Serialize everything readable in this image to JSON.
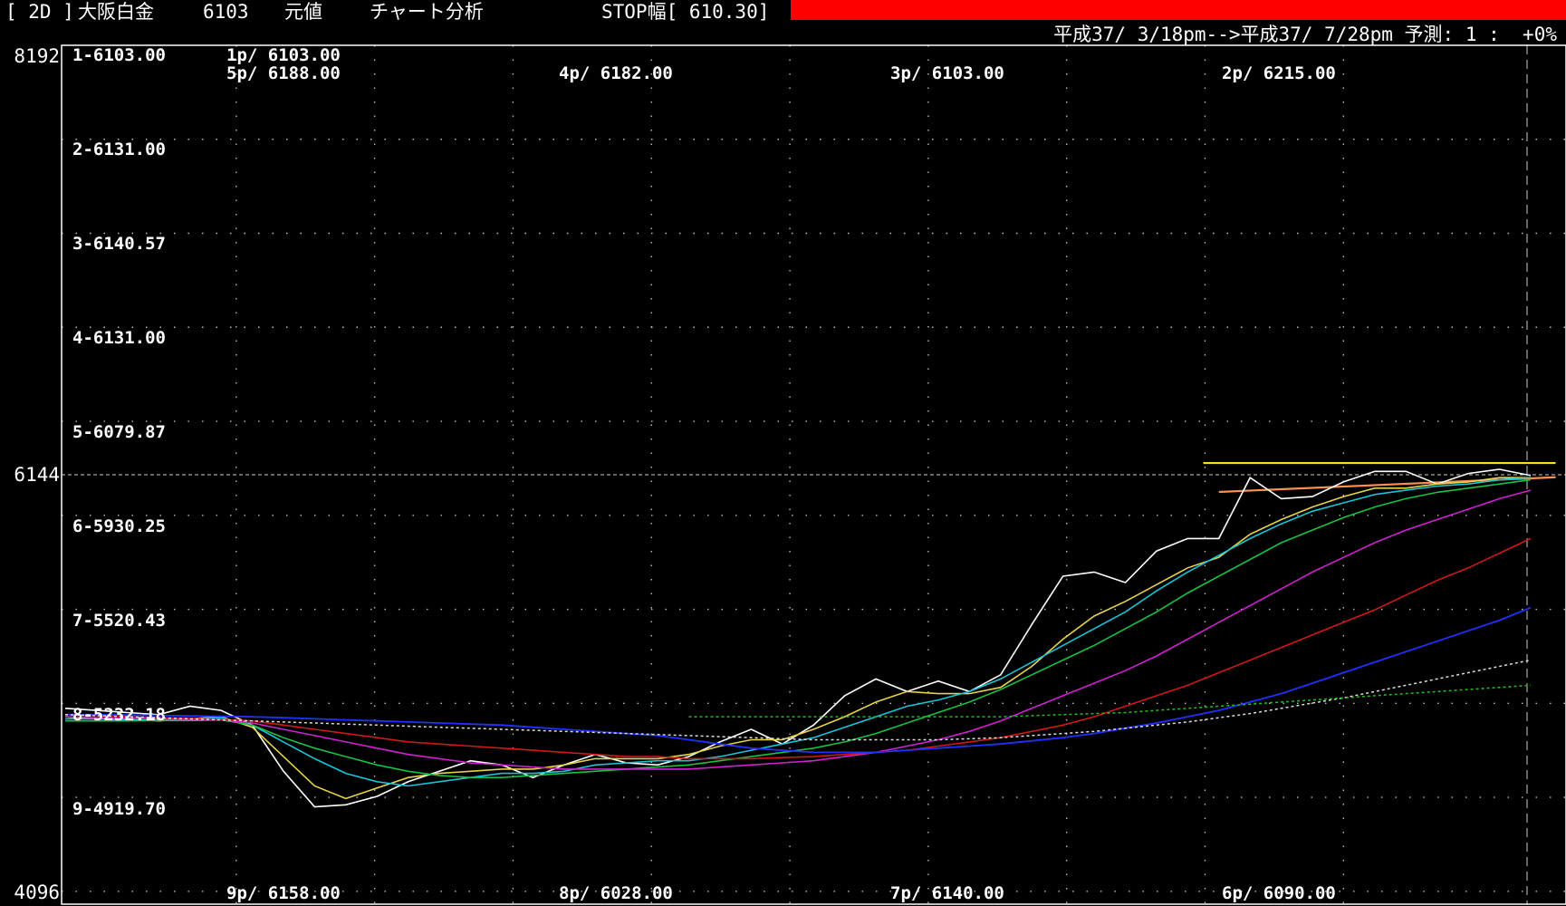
{
  "header": {
    "period": "[ 2D ]",
    "symbol": "大阪白金",
    "price": "6103",
    "mode": "元値",
    "analysis": "チャート分析",
    "stop": "STOP幅[ 610.30]",
    "range": "平成37/ 3/18pm-->平成37/ 7/28pm 予測: 1 :  +0%"
  },
  "axis": {
    "y_top": "8192",
    "y_mid": "6144",
    "y_bottom": "4096"
  },
  "colors": {
    "background": "#000000",
    "redbar": "#ff0000",
    "price": "#ffffff",
    "ma1": "#e6d34a",
    "ma2": "#18c4d8",
    "ma3": "#18c044",
    "ma4": "#d020d0",
    "ma5": "#d01818",
    "ma6": "#2030ff",
    "trend_top": "#ffe020",
    "trend_low": "#ff9050"
  },
  "chart_data": {
    "type": "line",
    "x": [
      0,
      1,
      2,
      3,
      4,
      5,
      6,
      7,
      8,
      9,
      10,
      11,
      12,
      13,
      14,
      15,
      16,
      17,
      18,
      19,
      20,
      21,
      22,
      23,
      24,
      25,
      26,
      27,
      28,
      29,
      30,
      31,
      32,
      33,
      34,
      35,
      36,
      37,
      38,
      39,
      40,
      41,
      42,
      43,
      44,
      45,
      46,
      47
    ],
    "ylim": [
      4096,
      8192
    ],
    "grid": true,
    "levels": [
      {
        "label": "1-6103.00"
      },
      {
        "label": "2-6131.00"
      },
      {
        "label": "3-6140.57"
      },
      {
        "label": "4-6131.00"
      },
      {
        "label": "5-6079.87"
      },
      {
        "label": "6-5930.25"
      },
      {
        "label": "7-5520.43"
      },
      {
        "label": "8-5232.18"
      },
      {
        "label": "9-4919.70"
      }
    ],
    "series_labels": [
      {
        "text": "1p/ 6103.00"
      },
      {
        "text": "5p/ 6188.00"
      },
      {
        "text": "4p/ 6182.00"
      },
      {
        "text": "3p/ 6103.00"
      },
      {
        "text": "2p/ 6215.00"
      },
      {
        "text": "9p/ 6158.00"
      },
      {
        "text": "8p/ 6028.00"
      },
      {
        "text": "7p/ 6140.00"
      },
      {
        "text": "6p/ 6090.00"
      }
    ],
    "series": [
      {
        "values": [
          5030,
          5020,
          5010,
          5000,
          5040,
          5020,
          4950,
          4730,
          4560,
          4570,
          4610,
          4680,
          4730,
          4780,
          4760,
          4700,
          4760,
          4810,
          4770,
          4760,
          4800,
          4870,
          4930,
          4860,
          4950,
          5090,
          5170,
          5110,
          5160,
          5110,
          5190,
          5430,
          5660,
          5680,
          5630,
          5780,
          5840,
          5840,
          6130,
          6030,
          6040,
          6110,
          6160,
          6160,
          6100,
          6150,
          6170,
          6140
        ]
      },
      {
        "values": [
          4990,
          4980,
          4980,
          4970,
          4980,
          4990,
          4940,
          4800,
          4660,
          4600,
          4650,
          4700,
          4720,
          4730,
          4740,
          4740,
          4760,
          4790,
          4790,
          4790,
          4810,
          4850,
          4880,
          4880,
          4930,
          4990,
          5060,
          5110,
          5100,
          5100,
          5130,
          5230,
          5360,
          5470,
          5540,
          5620,
          5700,
          5750,
          5860,
          5930,
          5990,
          6040,
          6080,
          6080,
          6100,
          6110,
          6130,
          6130
        ]
      },
      {
        "values": [
          4980,
          4980,
          4975,
          4975,
          4978,
          4985,
          4950,
          4870,
          4790,
          4720,
          4680,
          4660,
          4680,
          4700,
          4720,
          4720,
          4730,
          4760,
          4770,
          4780,
          4780,
          4800,
          4830,
          4860,
          4890,
          4940,
          4990,
          5040,
          5070,
          5110,
          5170,
          5250,
          5330,
          5410,
          5490,
          5590,
          5680,
          5760,
          5840,
          5910,
          5970,
          6010,
          6050,
          6070,
          6090,
          6100,
          6120,
          6130
        ]
      },
      {
        "values": [
          4970,
          4970,
          4970,
          4972,
          4972,
          4975,
          4950,
          4890,
          4840,
          4800,
          4760,
          4730,
          4710,
          4700,
          4700,
          4710,
          4720,
          4730,
          4740,
          4750,
          4760,
          4780,
          4800,
          4820,
          4840,
          4870,
          4910,
          4960,
          5010,
          5060,
          5120,
          5190,
          5260,
          5330,
          5410,
          5490,
          5580,
          5660,
          5740,
          5820,
          5880,
          5940,
          5990,
          6030,
          6060,
          6080,
          6100,
          6120
        ]
      },
      {
        "values": [
          4990,
          4985,
          4982,
          4980,
          4978,
          4975,
          4960,
          4930,
          4900,
          4870,
          4840,
          4810,
          4790,
          4770,
          4760,
          4750,
          4740,
          4740,
          4740,
          4740,
          4740,
          4750,
          4760,
          4770,
          4780,
          4800,
          4820,
          4850,
          4880,
          4920,
          4970,
          5030,
          5090,
          5150,
          5210,
          5280,
          5360,
          5440,
          5520,
          5600,
          5680,
          5750,
          5820,
          5880,
          5930,
          5980,
          6030,
          6070
        ]
      },
      {
        "values": [
          5000,
          4995,
          4990,
          4985,
          4982,
          4978,
          4970,
          4950,
          4930,
          4910,
          4890,
          4870,
          4860,
          4850,
          4840,
          4830,
          4820,
          4810,
          4800,
          4800,
          4790,
          4790,
          4790,
          4795,
          4800,
          4810,
          4820,
          4830,
          4850,
          4870,
          4890,
          4920,
          4950,
          4990,
          5040,
          5090,
          5140,
          5200,
          5260,
          5320,
          5380,
          5440,
          5500,
          5570,
          5640,
          5700,
          5770,
          5840
        ]
      },
      {
        "values": [
          5000,
          5000,
          4998,
          4996,
          4994,
          4992,
          4990,
          4985,
          4980,
          4975,
          4970,
          4965,
          4960,
          4955,
          4950,
          4940,
          4930,
          4920,
          4910,
          4900,
          4880,
          4860,
          4840,
          4830,
          4820,
          4820,
          4820,
          4830,
          4840,
          4850,
          4860,
          4875,
          4890,
          4910,
          4935,
          4960,
          4990,
          5020,
          5060,
          5100,
          5150,
          5200,
          5250,
          5300,
          5350,
          5400,
          5450,
          5510
        ]
      },
      {
        "values": [
          5000,
          4995,
          4990,
          4985,
          4980,
          4975,
          4970,
          4965,
          4960,
          4955,
          4950,
          4945,
          4940,
          4935,
          4930,
          4925,
          4920,
          4915,
          4910,
          4905,
          4900,
          4895,
          4890,
          4885,
          4880,
          4880,
          4880,
          4880,
          4880,
          4885,
          4890,
          4900,
          4910,
          4920,
          4935,
          4950,
          4965,
          4985,
          5005,
          5030,
          5055,
          5080,
          5110,
          5140,
          5170,
          5200,
          5230,
          5260
        ]
      },
      {
        "values": [
          null,
          null,
          null,
          null,
          null,
          null,
          null,
          null,
          null,
          null,
          null,
          null,
          null,
          null,
          null,
          null,
          null,
          null,
          null,
          null,
          4990,
          4990,
          4990,
          4990,
          4990,
          4990,
          4990,
          4990,
          4990,
          4990,
          4990,
          4995,
          5000,
          5005,
          5010,
          5020,
          5030,
          5040,
          5050,
          5060,
          5070,
          5080,
          5090,
          5100,
          5110,
          5120,
          5130,
          5140
        ]
      }
    ],
    "trendlines": [
      {
        "x": [
          36.5,
          47.8
        ],
        "y": [
          6200,
          6200
        ]
      },
      {
        "x": [
          37.0,
          47.8
        ],
        "y": [
          6062,
          6132
        ]
      }
    ]
  }
}
